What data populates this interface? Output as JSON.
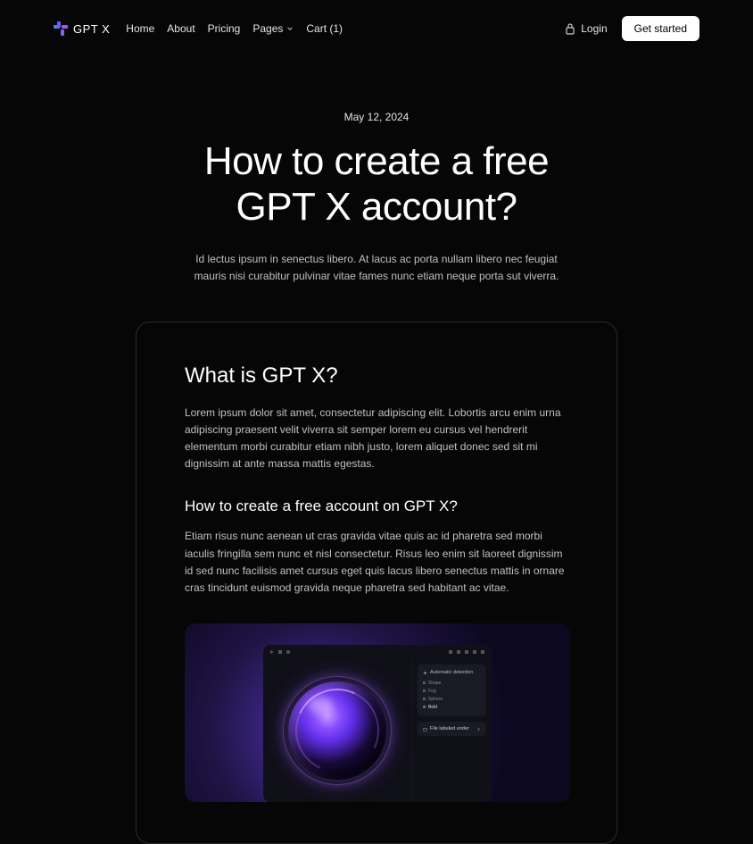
{
  "nav": {
    "logo_text": "GPT X",
    "links": {
      "home": "Home",
      "about": "About",
      "pricing": "Pricing",
      "pages": "Pages",
      "cart": "Cart (1)"
    },
    "login": "Login",
    "cta": "Get started"
  },
  "hero": {
    "date": "May 12, 2024",
    "title_line1": "How to create a free",
    "title_line2": "GPT X account?",
    "subtitle": "Id lectus ipsum in senectus libero. At lacus ac porta nullam libero nec feugiat mauris nisi curabitur pulvinar vitae fames nunc etiam neque porta sut viverra."
  },
  "content": {
    "h2_1": "What is GPT X?",
    "p1": "Lorem ipsum dolor sit amet, consectetur adipiscing elit. Lobortis arcu enim urna adipiscing praesent velit viverra sit semper lorem eu cursus vel hendrerit elementum morbi curabitur etiam nibh justo, lorem aliquet donec sed sit mi dignissim at ante massa mattis egestas.",
    "h3_1": "How to create a free account on GPT X?",
    "p2": "Etiam risus nunc aenean ut cras gravida vitae quis ac id pharetra sed morbi iaculis fringilla sem nunc et nisl consectetur. Risus leo enim sit laoreet dignissim id sed nunc facilisis amet cursus eget quis lacus libero senectus mattis in ornare cras tincidunt euismod gravida neque pharetra sed habitant ac vitae."
  },
  "figure_panel": {
    "title": "Automatic detection",
    "rows": [
      "Shape",
      "Fog",
      "Sphere",
      "Bold"
    ],
    "panel2": "File labeled under"
  }
}
